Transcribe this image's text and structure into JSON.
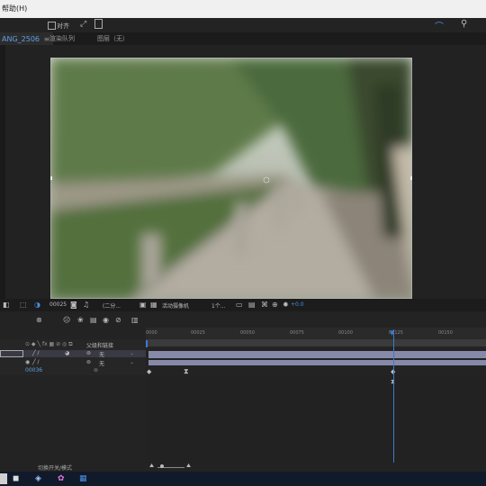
{
  "menubar": {
    "help_label": "帮助(H)"
  },
  "toolbar": {
    "align_label": "对齐"
  },
  "tabs": {
    "active": "ANG_2506",
    "layer_label": "图层（无）",
    "render_label": "渲染队列"
  },
  "viewer": {
    "timecode": "00025",
    "quality": "(二分...",
    "camera": "活动摄像机",
    "views": "1个...",
    "exposure": "+0.0"
  },
  "timeline": {
    "ruler": [
      "0000",
      "00025",
      "00050",
      "00075",
      "00100",
      "00125",
      "00150"
    ],
    "parent_header": "父级和链接",
    "rows": [
      {
        "parent": "无"
      },
      {
        "parent": "无"
      }
    ],
    "current_time": "00036"
  },
  "status": {
    "toggle_label": "切换开关/模式"
  },
  "colors": {
    "accent": "#3a7ad0",
    "layer_bar": "#8689a8"
  }
}
